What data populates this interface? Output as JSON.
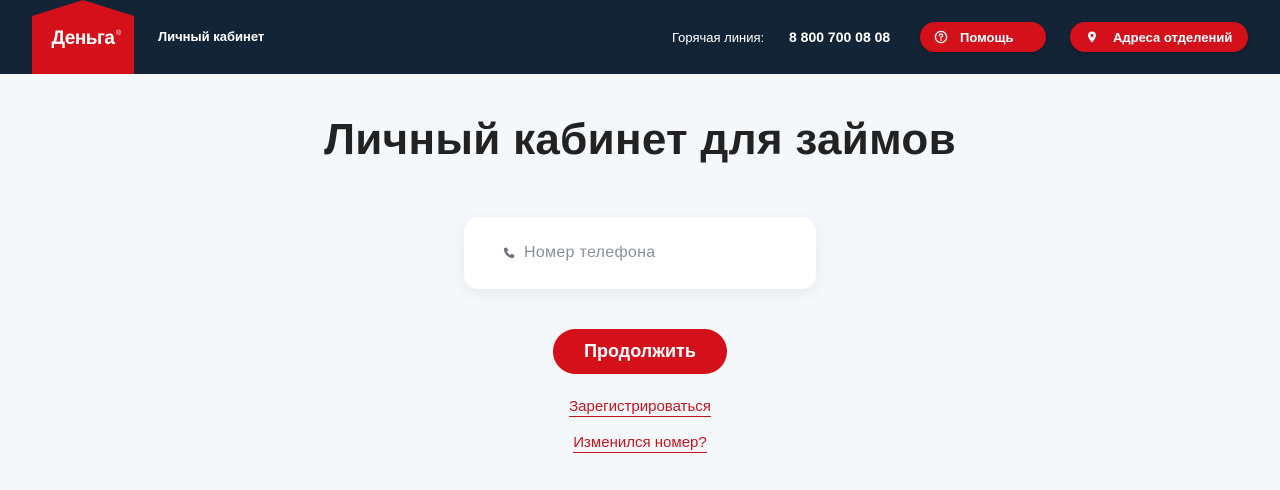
{
  "header": {
    "logo_text": "Деньга",
    "logo_mark": "®",
    "cabinet_link": "Личный кабинет",
    "hotline_label": "Горячая линия:",
    "hotline_number": "8 800 700 08 08",
    "help_button": {
      "label": "Помощь",
      "icon": "question-circle-icon"
    },
    "addresses_button": {
      "label": "Адреса отделений",
      "icon": "map-pin-icon"
    }
  },
  "main": {
    "title": "Личный кабинет для займов",
    "phone_field": {
      "value": "",
      "placeholder": "Номер телефона",
      "icon": "phone-icon"
    },
    "continue_button": "Продолжить",
    "register_link": "Зарегистрироваться",
    "changed_number_link": "Изменился номер?"
  },
  "colors": {
    "header_bg": "#132437",
    "accent_red": "#d4101b",
    "page_bg": "#f5f8fb",
    "link_red": "#c8141d"
  }
}
